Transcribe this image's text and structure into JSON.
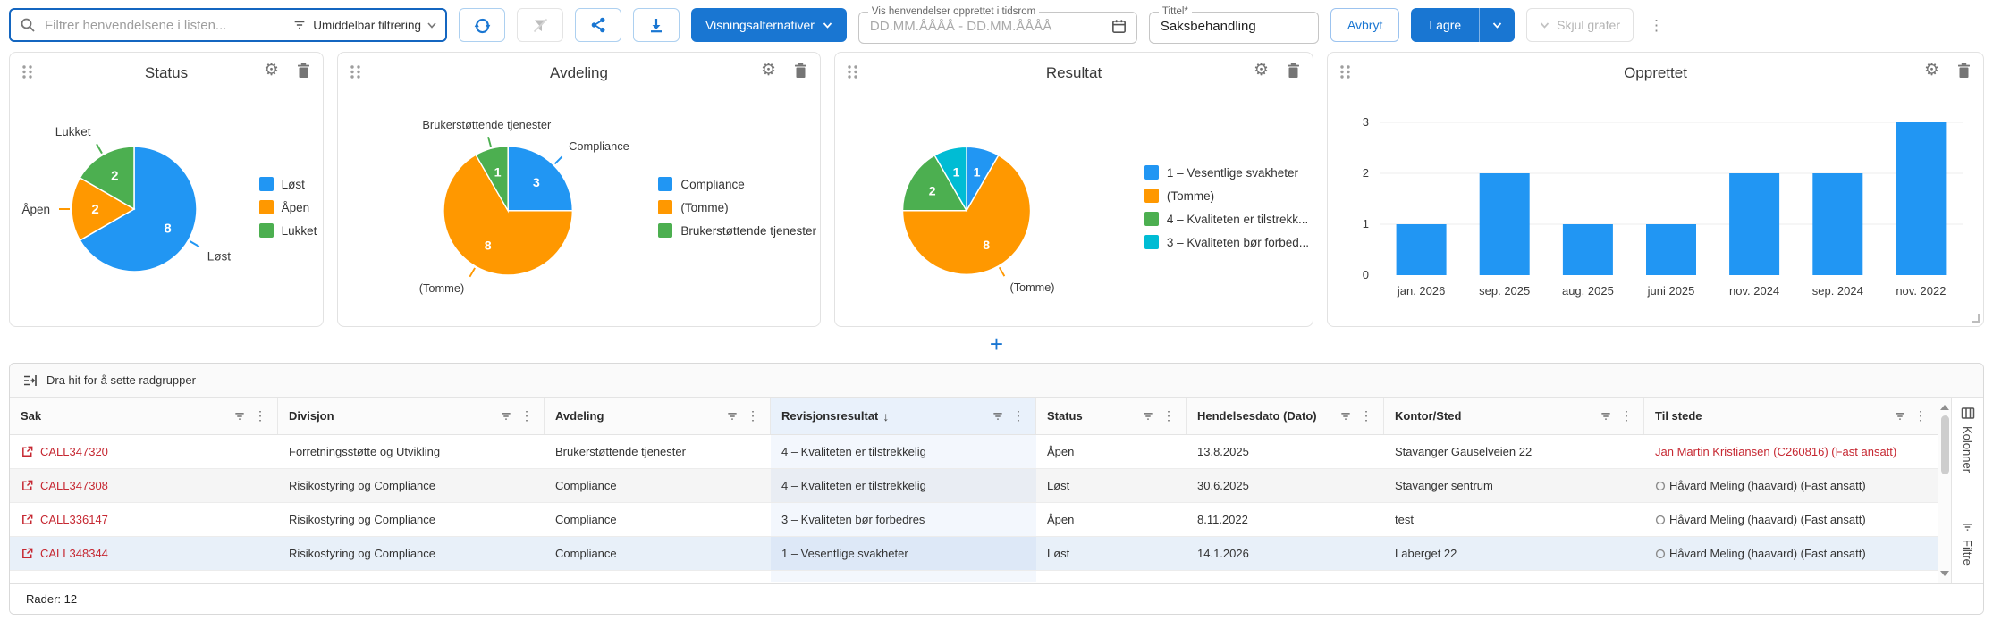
{
  "toolbar": {
    "search_placeholder": "Filtrer henvendelsene i listen...",
    "filter_mode_label": "Umiddelbar filtrering",
    "view_options_label": "Visningsalternativer",
    "date_range_label": "Vis henvendelser opprettet i tidsrom",
    "date_range_placeholder": "DD.MM.ÅÅÅÅ - DD.MM.ÅÅÅÅ",
    "title_label": "Tittel*",
    "title_value": "Saksbehandling",
    "cancel_label": "Avbryt",
    "save_label": "Lagre",
    "hide_charts_label": "Skjul grafer"
  },
  "icons": {
    "gear": "⚙",
    "kebab": "⋮",
    "sort_desc": "↓",
    "plus": "+",
    "chevron": "▾"
  },
  "colors": {
    "accent_blue": "#1976d2",
    "search_border": "#1466c0",
    "pie_blue": "#2196F3",
    "pie_orange": "#FF9800",
    "pie_green": "#4CAF50",
    "pie_cyan": "#00BCD4",
    "link_red": "#c62832",
    "sorted_column_bg": "#e9f1fb"
  },
  "chart_data": [
    {
      "type": "pie",
      "title": "Status",
      "slices": [
        {
          "label": "Løst",
          "value": 8,
          "color": "#2196F3",
          "callout": true
        },
        {
          "label": "Åpen",
          "value": 2,
          "color": "#FF9800",
          "callout": true
        },
        {
          "label": "Lukket",
          "value": 2,
          "color": "#4CAF50",
          "callout": true
        }
      ],
      "legend": [
        {
          "label": "Løst",
          "color": "#2196F3"
        },
        {
          "label": "Åpen",
          "color": "#FF9800"
        },
        {
          "label": "Lukket",
          "color": "#4CAF50"
        }
      ],
      "legend_position": "right"
    },
    {
      "type": "pie",
      "title": "Avdeling",
      "slices": [
        {
          "label": "Compliance",
          "value": 3,
          "color": "#2196F3",
          "callout": true
        },
        {
          "label": "(Tomme)",
          "value": 8,
          "color": "#FF9800",
          "callout": true
        },
        {
          "label": "Brukerstøttende tjenester",
          "value": 1,
          "color": "#4CAF50",
          "callout": true
        }
      ],
      "legend": [
        {
          "label": "Compliance",
          "color": "#2196F3"
        },
        {
          "label": "(Tomme)",
          "color": "#FF9800"
        },
        {
          "label": "Brukerstøttende tjenester",
          "color": "#4CAF50"
        }
      ],
      "legend_position": "right"
    },
    {
      "type": "pie",
      "title": "Resultat",
      "slices": [
        {
          "label": "1 – Vesentlige svakheter",
          "value": 1,
          "color": "#2196F3",
          "callout": false
        },
        {
          "label": "(Tomme)",
          "value": 8,
          "color": "#FF9800",
          "callout": true
        },
        {
          "label": "4 – Kvaliteten er tilstrekkelig",
          "value": 2,
          "color": "#4CAF50",
          "callout": false
        },
        {
          "label": "3 – Kvaliteten bør forbedres",
          "value": 1,
          "color": "#00BCD4",
          "callout": false
        }
      ],
      "legend": [
        {
          "label": "1 – Vesentlige svakheter",
          "color": "#2196F3"
        },
        {
          "label": "(Tomme)",
          "color": "#FF9800"
        },
        {
          "label": "4 – Kvaliteten er tilstrekk...",
          "color": "#4CAF50"
        },
        {
          "label": "3 – Kvaliteten bør forbed...",
          "color": "#00BCD4"
        }
      ],
      "legend_position": "right"
    },
    {
      "type": "bar",
      "title": "Opprettet",
      "categories": [
        "jan. 2026",
        "sep. 2025",
        "aug. 2025",
        "juni 2025",
        "nov. 2024",
        "sep. 2024",
        "nov. 2022"
      ],
      "values": [
        1,
        2,
        1,
        1,
        2,
        2,
        3
      ],
      "ylim": [
        0,
        3
      ],
      "yticks": [
        0,
        1,
        2,
        3
      ],
      "bar_color": "#2196F3",
      "grid": true,
      "legend_position": "none"
    }
  ],
  "table": {
    "row_group_hint": "Dra hit for å sette radgrupper",
    "columns": [
      {
        "key": "sak",
        "label": "Sak"
      },
      {
        "key": "divisjon",
        "label": "Divisjon"
      },
      {
        "key": "avdeling",
        "label": "Avdeling"
      },
      {
        "key": "resultat",
        "label": "Revisjonsresultat",
        "sorted": true
      },
      {
        "key": "status",
        "label": "Status"
      },
      {
        "key": "dato",
        "label": "Hendelsesdato (Dato)"
      },
      {
        "key": "kontor",
        "label": "Kontor/Sted"
      },
      {
        "key": "tilstede",
        "label": "Til stede"
      }
    ],
    "rows": [
      {
        "sak": "CALL347320",
        "divisjon": "Forretningsstøtte og Utvikling",
        "avdeling": "Brukerstøttende tjenester",
        "resultat": "4 – Kvaliteten er tilstrekkelig",
        "status": "Åpen",
        "dato": "13.8.2025",
        "kontor": "Stavanger Gauselveien 22",
        "tilstede": "Jan Martin Kristiansen (C260816) (Fast ansatt)",
        "tilstede_red": true,
        "bg": "white"
      },
      {
        "sak": "CALL347308",
        "divisjon": "Risikostyring og Compliance",
        "avdeling": "Compliance",
        "resultat": "4 – Kvaliteten er tilstrekkelig",
        "status": "Løst",
        "dato": "30.6.2025",
        "kontor": "Stavanger sentrum",
        "tilstede": "Håvard Meling (haavard) (Fast ansatt)",
        "tilstede_red": false,
        "bg": "gray"
      },
      {
        "sak": "CALL336147",
        "divisjon": "Risikostyring og Compliance",
        "avdeling": "Compliance",
        "resultat": "3 – Kvaliteten bør forbedres",
        "status": "Åpen",
        "dato": "8.11.2022",
        "kontor": "test",
        "tilstede": "Håvard Meling (haavard) (Fast ansatt)",
        "tilstede_red": false,
        "bg": "white"
      },
      {
        "sak": "CALL348344",
        "divisjon": "Risikostyring og Compliance",
        "avdeling": "Compliance",
        "resultat": "1 – Vesentlige svakheter",
        "status": "Løst",
        "dato": "14.1.2026",
        "kontor": "Laberget 22",
        "tilstede": "Håvard Meling (haavard) (Fast ansatt)",
        "tilstede_red": false,
        "bg": "blue"
      }
    ],
    "footer": "Rader: 12",
    "side_tabs": [
      {
        "label": "Kolonner"
      },
      {
        "label": "Filtre"
      }
    ]
  }
}
